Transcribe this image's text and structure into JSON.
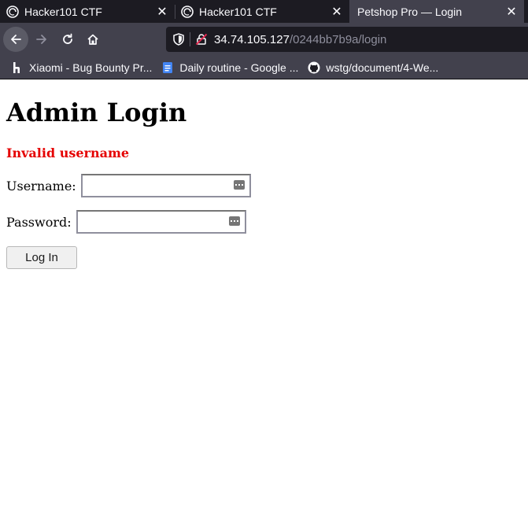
{
  "browser": {
    "tabs": [
      {
        "title": "Hacker101 CTF",
        "active": false,
        "icon": "hacker101-icon"
      },
      {
        "title": "Hacker101 CTF",
        "active": false,
        "icon": "hacker101-icon"
      },
      {
        "title": "Petshop Pro — Login",
        "active": true,
        "icon": ""
      }
    ],
    "close_glyph": "✕",
    "url_host": "34.74.105.127",
    "url_path": "/0244bb7b9a/login",
    "bookmarks": [
      {
        "label": "Xiaomi - Bug Bounty Pr...",
        "icon": "hackerone-icon"
      },
      {
        "label": "Daily routine - Google ...",
        "icon": "google-docs-icon"
      },
      {
        "label": "wstg/document/4-We...",
        "icon": "github-icon"
      }
    ]
  },
  "page": {
    "heading": "Admin Login",
    "error": "Invalid username",
    "username_label": "Username:",
    "username_value": "",
    "password_label": "Password:",
    "password_value": "",
    "login_button": "Log In",
    "error_color": "#e50000"
  }
}
